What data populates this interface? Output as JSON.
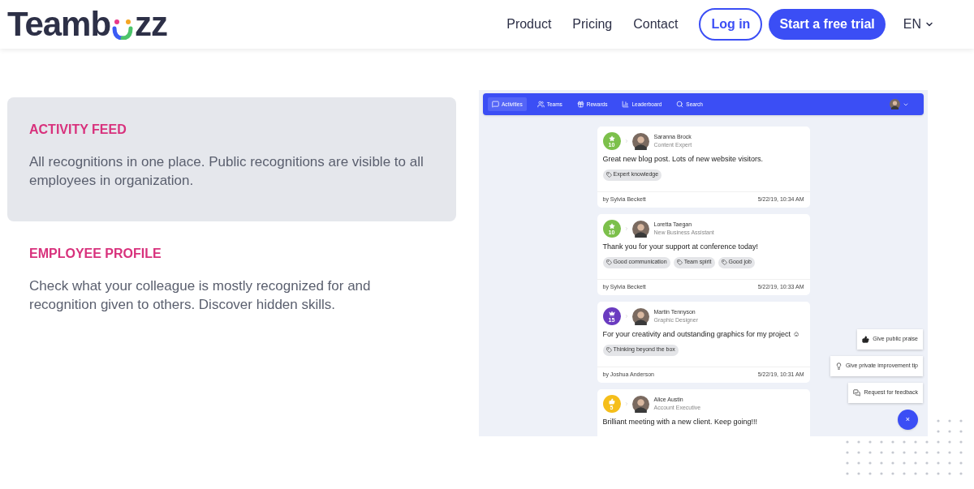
{
  "logo": {
    "before": "Teamb",
    "after": "zz"
  },
  "nav": {
    "links": [
      "Product",
      "Pricing",
      "Contact"
    ],
    "login": "Log in",
    "trial": "Start a free trial",
    "language": "EN"
  },
  "features": [
    {
      "title": "ACTIVITY FEED",
      "text": "All recognitions in one place. Public recognitions are visible to all employees in organization.",
      "selected": true
    },
    {
      "title": "EMPLOYEE PROFILE",
      "text": "Check what your colleague is mostly recognized for and recognition given to others. Discover hidden skills.",
      "selected": false
    }
  ],
  "app": {
    "tabs": [
      {
        "label": "Activities",
        "selected": true
      },
      {
        "label": "Teams",
        "selected": false
      },
      {
        "label": "Rewards",
        "selected": false
      },
      {
        "label": "Leaderboard",
        "selected": false
      },
      {
        "label": "Search",
        "selected": false
      }
    ],
    "feed": [
      {
        "badge": {
          "kind": "star",
          "count": "10",
          "color": "#7cc04b"
        },
        "name": "Saranna Brock",
        "role": "Content Expert",
        "message": "Great new blog post. Lots of new website visitors.",
        "tags": [
          "Expert knowledge"
        ],
        "by": "by Sylvia Beckett",
        "time": "5/22/19, 10:34 AM"
      },
      {
        "badge": {
          "kind": "star",
          "count": "10",
          "color": "#7cc04b"
        },
        "name": "Loretta Taegan",
        "role": "New Business Assistant",
        "message": "Thank you for your support at conference today!",
        "tags": [
          "Good communication",
          "Team spirit",
          "Good job"
        ],
        "by": "by Sylvia Beckett",
        "time": "5/22/19, 10:33 AM"
      },
      {
        "badge": {
          "kind": "crown",
          "count": "15",
          "color": "#6a3bc0"
        },
        "name": "Martin Tennyson",
        "role": "Graphic Designer",
        "message": "For your creativity and outstanding graphics for my project ☺",
        "tags": [
          "Thinking beyond the box"
        ],
        "by": "by Joshua Anderson",
        "time": "5/22/19, 10:31 AM"
      },
      {
        "badge": {
          "kind": "thumb",
          "count": "5",
          "color": "#f5be1a"
        },
        "name": "Alice Austin",
        "role": "Account Executive",
        "message": "Brilliant meeting with a new client. Keep going!!!"
      }
    ],
    "actions": [
      "Give public praise",
      "Give private improvement tip",
      "Request for feedback"
    ],
    "close": "×"
  }
}
